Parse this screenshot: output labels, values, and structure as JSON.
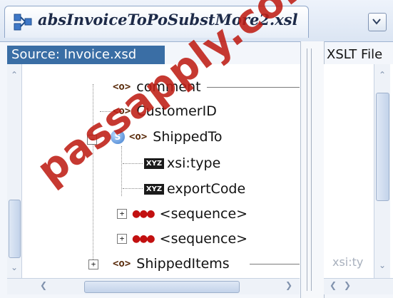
{
  "editor": {
    "tab_title": "absInvoiceToPoSubstMore2.xsl",
    "tab_icon": "xsl-mapper-icon",
    "menu_icon": "chevron-down-icon"
  },
  "source_pane": {
    "header": "Source: Invoice.xsd",
    "tree": [
      {
        "label": "comment",
        "icon": "element-icon"
      },
      {
        "label": "CustomerID",
        "icon": "element-icon"
      },
      {
        "label": "ShippedTo",
        "icon": "element-icon",
        "badge": "S",
        "expanded": true
      },
      {
        "label": "xsi:type",
        "icon": "attribute-icon",
        "badge": "XYZ"
      },
      {
        "label": "exportCode",
        "icon": "attribute-icon",
        "badge": "XYZ"
      },
      {
        "label": "<sequence>",
        "icon": "sequence-icon",
        "expanded": false
      },
      {
        "label": "<sequence>",
        "icon": "sequence-icon",
        "expanded": false
      },
      {
        "label": "ShippedItems",
        "icon": "element-icon",
        "expanded": false
      }
    ]
  },
  "target_pane": {
    "header": "XSLT File",
    "faded_item": "xsi:ty"
  },
  "watermark": "passapply.com",
  "colors": {
    "selection": "#3a6ea5",
    "watermark": "#be1e14",
    "tab_title": "#1d2a48"
  }
}
